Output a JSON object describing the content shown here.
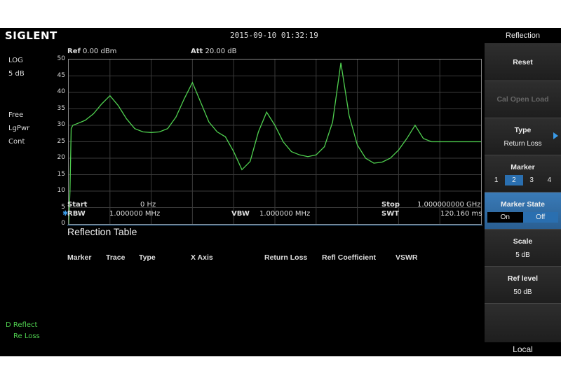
{
  "brand": "SIGLENT",
  "datetime": "2015-09-10   01:32:19",
  "left_panel": {
    "scale_type": "LOG",
    "scale_div": "5  dB",
    "trigger": "Free",
    "det": "LgPwr",
    "sweep": "Cont",
    "trace_label_1": "D Reflect",
    "trace_label_2": "Re Loss"
  },
  "header": {
    "ref_label": "Ref",
    "ref_value": "0.00 dBm",
    "att_label": "Att",
    "att_value": "20.00 dB"
  },
  "footer": {
    "start_label": "Start",
    "start_value": "0    Hz",
    "stop_label": "Stop",
    "stop_value": "1.000000000  GHz",
    "rbw_label": "RBW",
    "rbw_value": "1.000000  MHz",
    "vbw_label": "VBW",
    "vbw_value": "1.000000  MHz",
    "swt_label": "SWT",
    "swt_value": "120.160 ms"
  },
  "table": {
    "title": "Reflection Table",
    "columns": [
      "Marker",
      "Trace",
      "Type",
      "X Axis",
      "Return Loss",
      "Refl Coefficient",
      "VSWR"
    ]
  },
  "menu": {
    "title": "Reflection",
    "reset": "Reset",
    "cal_open_load": "Cal Open Load",
    "type_label": "Type",
    "type_value": "Return Loss",
    "marker_label": "Marker",
    "marker_options": [
      "1",
      "2",
      "3",
      "4"
    ],
    "marker_selected": "2",
    "marker_state_label": "Marker State",
    "marker_state_on": "On",
    "marker_state_off": "Off",
    "scale_label": "Scale",
    "scale_value": "5 dB",
    "ref_level_label": "Ref level",
    "ref_level_value": "50 dB",
    "local": "Local"
  },
  "chart_data": {
    "type": "line",
    "ylim": [
      0,
      50
    ],
    "yticks": [
      0,
      5,
      10,
      15,
      20,
      25,
      30,
      35,
      40,
      45,
      50
    ],
    "xlim": [
      0,
      1000
    ],
    "x_unit": "MHz",
    "grid": true,
    "trace_color": "#4fcf4f",
    "series": [
      {
        "x": [
          0,
          3,
          6,
          10,
          20,
          40,
          60,
          80,
          100,
          120,
          140,
          160,
          180,
          200,
          220,
          240,
          260,
          280,
          300,
          320,
          340,
          360,
          380,
          400,
          420,
          440,
          460,
          480,
          500,
          520,
          540,
          560,
          580,
          600,
          620,
          640,
          660,
          680,
          700,
          720,
          740,
          760,
          780,
          800,
          820,
          840,
          860,
          880,
          900,
          920,
          940,
          960,
          980,
          1000
        ],
        "values": [
          0,
          10,
          29,
          30,
          30.5,
          31.5,
          33.5,
          36.5,
          39,
          36,
          32,
          29,
          28,
          27.8,
          28,
          29,
          32.5,
          38,
          43,
          37,
          31,
          28,
          26.5,
          22,
          16.5,
          19,
          28,
          34,
          30,
          25,
          22,
          21,
          20.5,
          21,
          23.5,
          31,
          49,
          33,
          24,
          20,
          18.5,
          18.8,
          20,
          22.5,
          26,
          30,
          26,
          25,
          25,
          25,
          25,
          25,
          25,
          25
        ]
      }
    ]
  }
}
